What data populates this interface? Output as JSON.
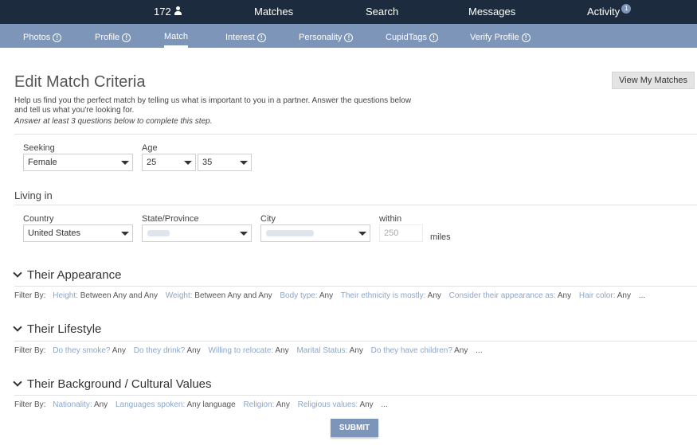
{
  "topnav": {
    "count": "172",
    "matches": "Matches",
    "search": "Search",
    "messages": "Messages",
    "activity": "Activity",
    "activity_badge": "1"
  },
  "subnav": {
    "tabs": [
      {
        "label": "Photos",
        "info": "!"
      },
      {
        "label": "Profile",
        "info": "!"
      },
      {
        "label": "Match"
      },
      {
        "label": "Interest",
        "info": "!"
      },
      {
        "label": "Personality",
        "info": "!"
      },
      {
        "label": "CupidTags",
        "info": "!"
      },
      {
        "label": "Verify Profile",
        "info": "!"
      }
    ],
    "active": "Match"
  },
  "page": {
    "title": "Edit Match Criteria",
    "view_matches": "View My Matches",
    "intro": "Help us find you the perfect match by telling us what is important to you in a partner. Answer the questions below and tell us what you're looking for.",
    "hint": "Answer at least 3 questions below to complete this step."
  },
  "seeking": {
    "label": "Seeking",
    "value": "Female"
  },
  "age": {
    "label": "Age",
    "min": "25",
    "max": "35"
  },
  "living": {
    "title": "Living in",
    "country_label": "Country",
    "country": "United States",
    "state_label": "State/Province",
    "city_label": "City",
    "within_label": "within",
    "within_placeholder": "250",
    "miles": "miles"
  },
  "appearance": {
    "title": "Their Appearance",
    "filter_label": "Filter By:",
    "items": [
      {
        "k": "Height:",
        "v": "Between Any and Any"
      },
      {
        "k": "Weight:",
        "v": "Between Any and Any"
      },
      {
        "k": "Body type:",
        "v": "Any"
      },
      {
        "k": "Their ethnicity is mostly:",
        "v": "Any"
      },
      {
        "k": "Consider their appearance as:",
        "v": "Any"
      },
      {
        "k": "Hair color:",
        "v": "Any"
      }
    ],
    "more": "..."
  },
  "lifestyle": {
    "title": "Their Lifestyle",
    "filter_label": "Filter By:",
    "items": [
      {
        "k": "Do they smoke?",
        "v": "Any"
      },
      {
        "k": "Do they drink?",
        "v": "Any"
      },
      {
        "k": "Willing to relocate:",
        "v": "Any"
      },
      {
        "k": "Marital Status:",
        "v": "Any"
      },
      {
        "k": "Do they have children?",
        "v": "Any"
      }
    ],
    "more": "..."
  },
  "background": {
    "title": "Their Background / Cultural Values",
    "filter_label": "Filter By:",
    "items": [
      {
        "k": "Nationality:",
        "v": "Any"
      },
      {
        "k": "Languages spoken:",
        "v": "Any language"
      },
      {
        "k": "Religion:",
        "v": "Any"
      },
      {
        "k": "Religious values:",
        "v": "Any"
      }
    ],
    "more": "..."
  },
  "submit": "SUBMIT",
  "colors": {
    "topbar": "#1c2b3d",
    "subbar": "#7d95b8",
    "link": "#8aa6cc"
  }
}
